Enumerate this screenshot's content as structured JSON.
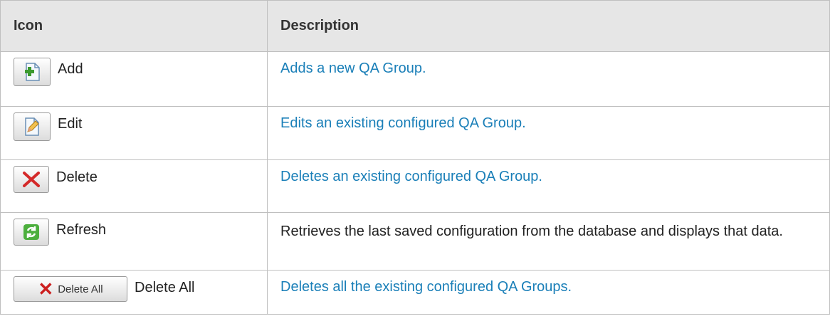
{
  "table": {
    "headers": {
      "icon": "Icon",
      "description": "Description"
    },
    "rows": [
      {
        "icon_name": "add-icon",
        "label": "Add",
        "description": "Adds a new QA Group.",
        "is_link": true
      },
      {
        "icon_name": "edit-icon",
        "label": "Edit",
        "description": "Edits an existing configured QA Group.",
        "is_link": true
      },
      {
        "icon_name": "delete-icon",
        "label": "Delete",
        "description": "Deletes an existing configured QA Group.",
        "is_link": true
      },
      {
        "icon_name": "refresh-icon",
        "label": "Refresh",
        "description": "Retrieves the last saved configuration from the database and displays that data.",
        "is_link": false
      },
      {
        "icon_name": "delete-all-icon",
        "label": "Delete All",
        "button_text": "Delete All",
        "description": "Deletes all the existing configured QA Groups.",
        "is_link": true
      }
    ]
  },
  "colors": {
    "link": "#1a7fb8",
    "header_bg": "#e6e6e6",
    "border": "#bfbfbf"
  }
}
